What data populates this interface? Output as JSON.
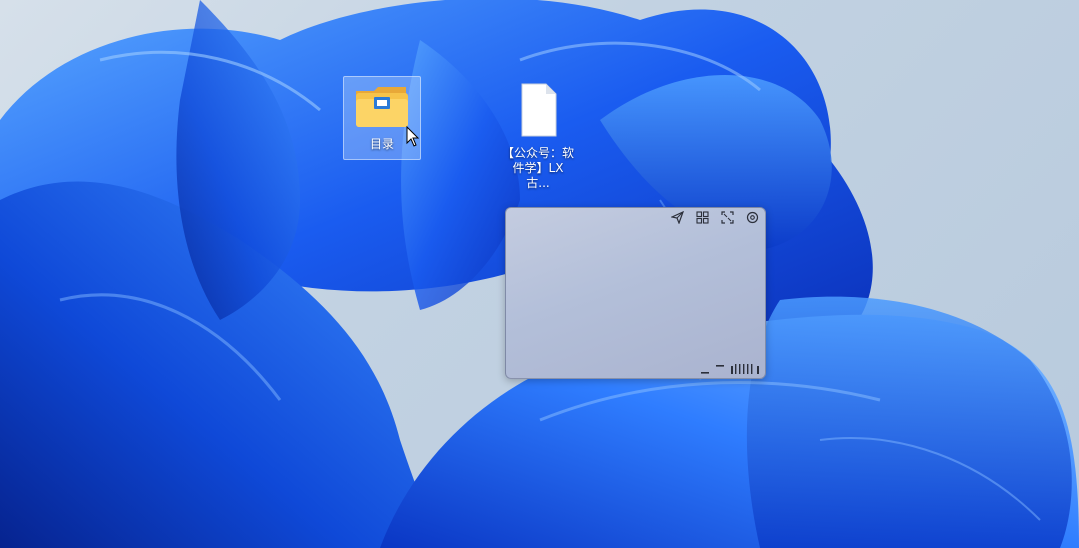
{
  "desktop": {
    "accent": "#1f5fe0",
    "icons": [
      {
        "label": "目录",
        "icon": "folder-icon",
        "selected": true
      },
      {
        "label": "【公众号：软件学】LX古...",
        "icon": "file-icon",
        "selected": false
      }
    ]
  },
  "widget": {
    "toolbar": [
      {
        "icon": "send-icon"
      },
      {
        "icon": "grid-icon"
      },
      {
        "icon": "fullscreen-icon"
      },
      {
        "icon": "settings-icon"
      }
    ],
    "status": [
      {
        "icon": "underscore-icon"
      },
      {
        "icon": "dash-icon"
      },
      {
        "icon": "level-bars-icon"
      }
    ]
  }
}
